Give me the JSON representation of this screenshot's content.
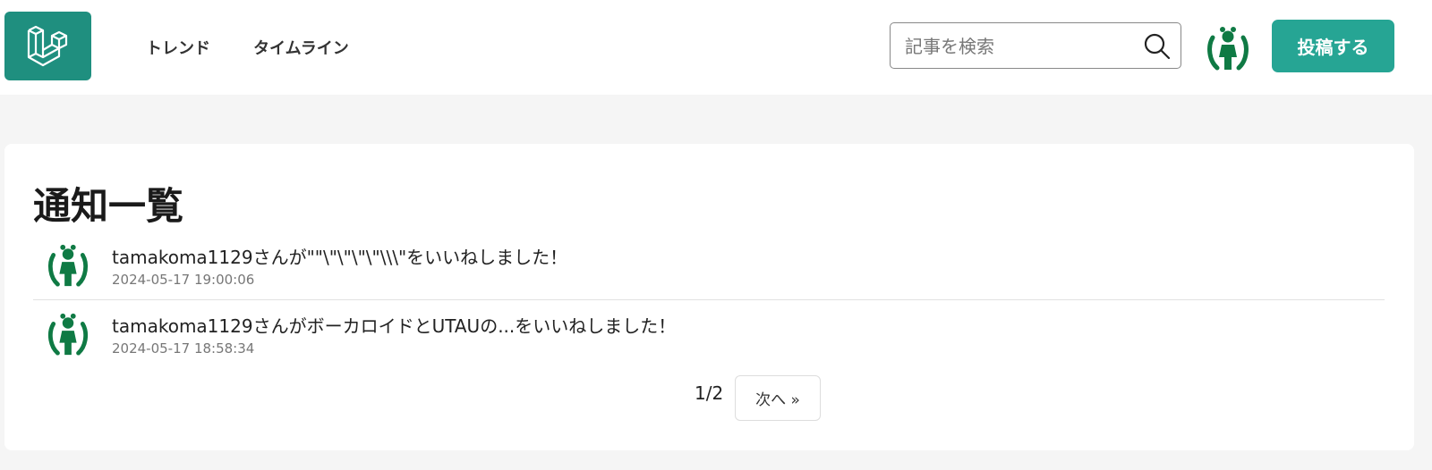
{
  "header": {
    "logo_icon": "laravel-logo-icon",
    "nav": [
      {
        "label": "トレンド"
      },
      {
        "label": "タイムライン"
      }
    ],
    "search": {
      "placeholder": "記事を検索",
      "value": "",
      "icon": "search-icon"
    },
    "user_avatar_icon": "user-avatar-icon",
    "post_label": "投稿する"
  },
  "main": {
    "title": "通知一覧",
    "notifications": [
      {
        "message": "tamakoma1129さんが\"\"\\\"\\\"\\\"\\\"\\\\\\\"をいいねしました！",
        "time": "2024-05-17 19:00:06"
      },
      {
        "message": "tamakoma1129さんがボーカロイドとUTAUの...をいいねしました！",
        "time": "2024-05-17 18:58:34"
      }
    ],
    "pagination": {
      "page": "1/2",
      "next_label": "次へ »"
    }
  },
  "colors": {
    "brand": "#26a594",
    "logo_bg": "#1f8f7f",
    "avatar_green": "#0f7a44",
    "page_bg": "#f5f5f5"
  }
}
